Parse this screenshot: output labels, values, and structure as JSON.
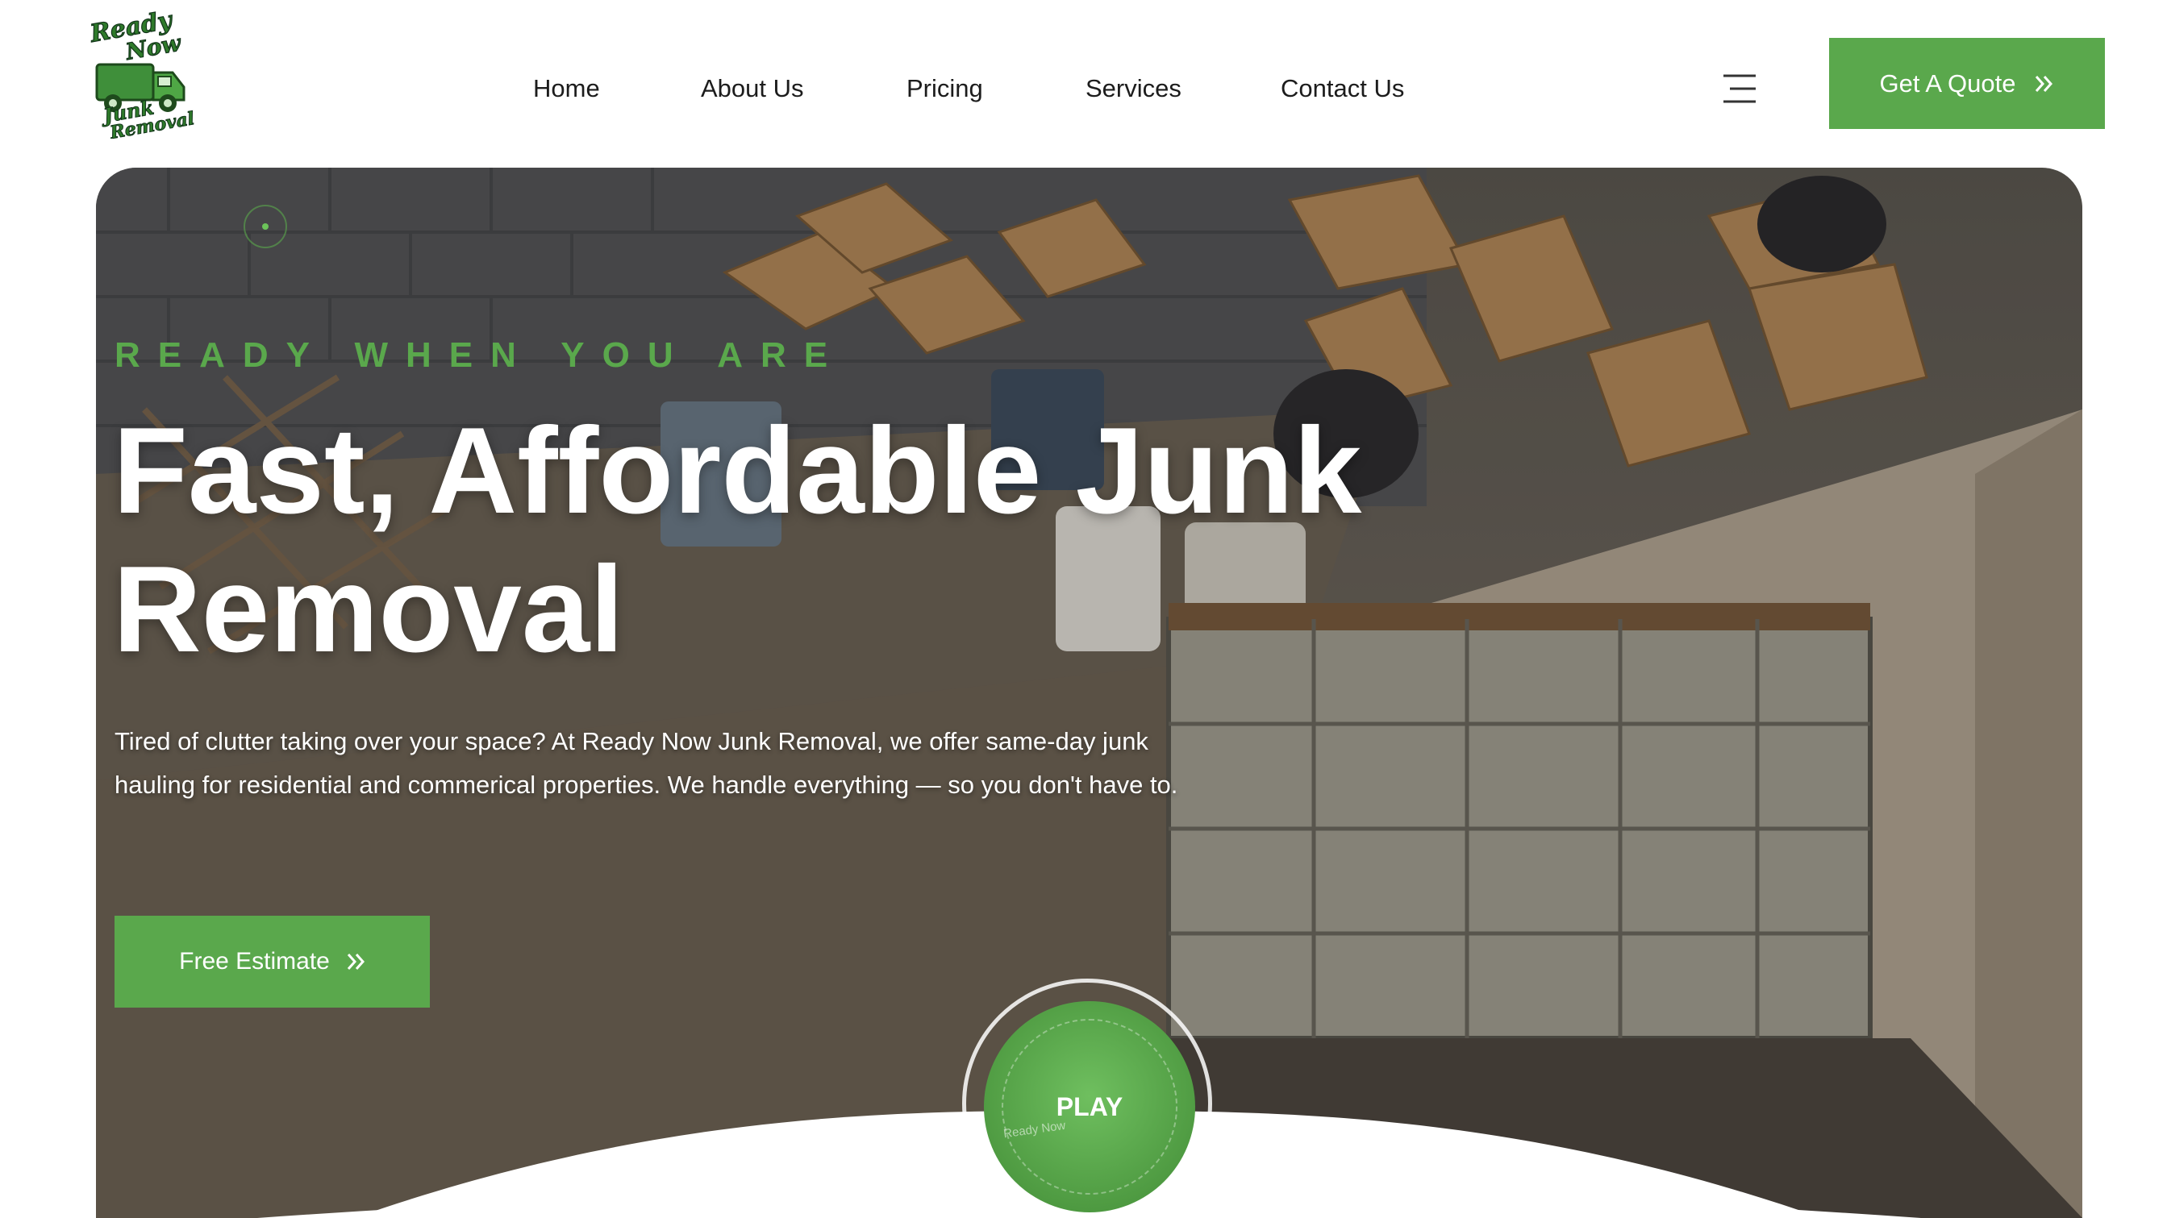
{
  "brand": {
    "logo_lines": [
      "Ready",
      "Now",
      "Junk",
      "Removal"
    ],
    "accent_color": "#5aa84c"
  },
  "nav": {
    "items": [
      {
        "label": "Home"
      },
      {
        "label": "About Us"
      },
      {
        "label": "Pricing"
      },
      {
        "label": "Services"
      },
      {
        "label": "Contact Us"
      }
    ],
    "menu_icon": "hamburger-menu-icon"
  },
  "header": {
    "cta_label": "Get A Quote",
    "cta_icon": "double-chevron-right-icon"
  },
  "hero": {
    "eyebrow": "READY WHEN YOU ARE",
    "headline_line1": "Fast, Affordable Junk",
    "headline_line2": "Removal",
    "description": "Tired of clutter taking over your space? At Ready Now Junk Removal, we offer same-day junk hauling for residential and commerical properties. We handle everything — so you don't have to.",
    "cta_label": "Free Estimate",
    "cta_icon": "double-chevron-right-icon",
    "play_label": "PLAY",
    "play_watermark": "Ready Now"
  }
}
